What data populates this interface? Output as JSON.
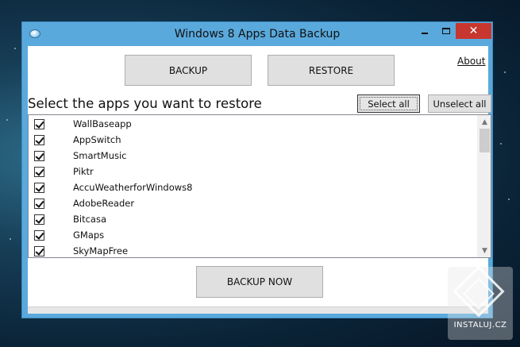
{
  "window": {
    "title": "Windows 8 Apps Data Backup",
    "close_glyph": "✕"
  },
  "toolbar": {
    "backup_label": "BACKUP",
    "restore_label": "RESTORE",
    "about_label": "About"
  },
  "section": {
    "heading": "Select the apps you want to restore",
    "select_all_label": "Select all",
    "unselect_all_label": "Unselect all"
  },
  "apps": [
    {
      "name": "WallBaseapp",
      "checked": true
    },
    {
      "name": "AppSwitch",
      "checked": true
    },
    {
      "name": "SmartMusic",
      "checked": true
    },
    {
      "name": "Piktr",
      "checked": true
    },
    {
      "name": "AccuWeatherforWindows8",
      "checked": true
    },
    {
      "name": "AdobeReader",
      "checked": true
    },
    {
      "name": "Bitcasa",
      "checked": true
    },
    {
      "name": "GMaps",
      "checked": true
    },
    {
      "name": "SkyMapFree",
      "checked": true
    }
  ],
  "scrollbar": {
    "up_glyph": "▲",
    "down_glyph": "▼"
  },
  "actions": {
    "backup_now_label": "BACKUP NOW"
  },
  "watermark": {
    "text": "INSTALUJ.CZ"
  },
  "colors": {
    "titlebar": "#5aa9dc",
    "close_button": "#c7372f"
  }
}
